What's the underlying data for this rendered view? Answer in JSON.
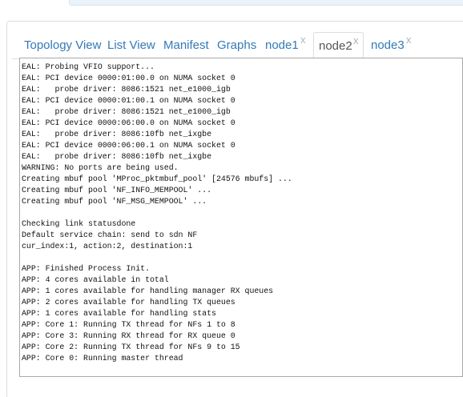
{
  "tabs": [
    {
      "label": "Topology View",
      "closable": false,
      "active": false
    },
    {
      "label": "List View",
      "closable": false,
      "active": false
    },
    {
      "label": "Manifest",
      "closable": false,
      "active": false
    },
    {
      "label": "Graphs",
      "closable": false,
      "active": false
    },
    {
      "label": "node1",
      "closable": true,
      "active": false
    },
    {
      "label": "node2",
      "closable": true,
      "active": true
    },
    {
      "label": "node3",
      "closable": true,
      "active": false
    }
  ],
  "close_glyph": "x",
  "console": {
    "lines": [
      "EAL: Probing VFIO support...",
      "EAL: PCI device 0000:01:00.0 on NUMA socket 0",
      "EAL:   probe driver: 8086:1521 net_e1000_igb",
      "EAL: PCI device 0000:01:00.1 on NUMA socket 0",
      "EAL:   probe driver: 8086:1521 net_e1000_igb",
      "EAL: PCI device 0000:06:00.0 on NUMA socket 0",
      "EAL:   probe driver: 8086:10fb net_ixgbe",
      "EAL: PCI device 0000:06:00.1 on NUMA socket 0",
      "EAL:   probe driver: 8086:10fb net_ixgbe",
      "WARNING: No ports are being used.",
      "Creating mbuf pool 'MProc_pktmbuf_pool' [24576 mbufs] ...",
      "Creating mbuf pool 'NF_INFO_MEMPOOL' ...",
      "Creating mbuf pool 'NF_MSG_MEMPOOL' ...",
      "",
      "Checking link statusdone",
      "Default service chain: send to sdn NF",
      "cur_index:1, action:2, destination:1",
      "",
      "APP: Finished Process Init.",
      "APP: 4 cores available in total",
      "APP: 1 cores available for handling manager RX queues",
      "APP: 2 cores available for handling TX queues",
      "APP: 1 cores available for handling stats",
      "APP: Core 1: Running TX thread for NFs 1 to 8",
      "APP: Core 3: Running RX thread for RX queue 0",
      "APP: Core 2: Running TX thread for NFs 9 to 15",
      "APP: Core 0: Running master thread"
    ]
  }
}
